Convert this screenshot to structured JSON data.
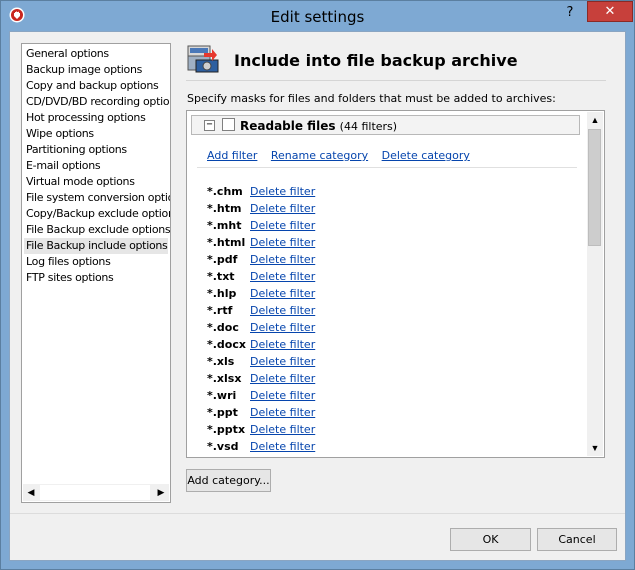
{
  "window": {
    "title": "Edit settings",
    "help_label": "?",
    "close_label": "✕"
  },
  "nav": {
    "items": [
      {
        "label": "General options",
        "selected": false
      },
      {
        "label": "Backup image options",
        "selected": false
      },
      {
        "label": "Copy and backup options",
        "selected": false
      },
      {
        "label": "CD/DVD/BD recording options",
        "selected": false
      },
      {
        "label": "Hot processing options",
        "selected": false
      },
      {
        "label": "Wipe options",
        "selected": false
      },
      {
        "label": "Partitioning options",
        "selected": false
      },
      {
        "label": "E-mail options",
        "selected": false
      },
      {
        "label": "Virtual mode options",
        "selected": false
      },
      {
        "label": "File system conversion options",
        "selected": false
      },
      {
        "label": "Copy/Backup exclude options",
        "selected": false
      },
      {
        "label": "File Backup exclude options",
        "selected": false
      },
      {
        "label": "File Backup include options",
        "selected": true
      },
      {
        "label": "Log files options",
        "selected": false
      },
      {
        "label": "FTP sites options",
        "selected": false
      }
    ]
  },
  "page": {
    "title": "Include into file backup archive",
    "description": "Specify masks for  files and folders that must be added to archives:"
  },
  "category": {
    "toggle": "−",
    "name": "Readable files",
    "count": "(44 filters)",
    "actions": {
      "add": "Add filter",
      "rename": "Rename category",
      "delete": "Delete category"
    }
  },
  "filters": [
    {
      "mask": "*.chm",
      "delete_label": "Delete filter"
    },
    {
      "mask": "*.htm",
      "delete_label": "Delete filter"
    },
    {
      "mask": "*.mht",
      "delete_label": "Delete filter"
    },
    {
      "mask": "*.html",
      "delete_label": "Delete filter"
    },
    {
      "mask": "*.pdf",
      "delete_label": "Delete filter"
    },
    {
      "mask": "*.txt",
      "delete_label": "Delete filter"
    },
    {
      "mask": "*.hlp",
      "delete_label": "Delete filter"
    },
    {
      "mask": "*.rtf",
      "delete_label": "Delete filter"
    },
    {
      "mask": "*.doc",
      "delete_label": "Delete filter"
    },
    {
      "mask": "*.docx",
      "delete_label": "Delete filter"
    },
    {
      "mask": "*.xls",
      "delete_label": "Delete filter"
    },
    {
      "mask": "*.xlsx",
      "delete_label": "Delete filter"
    },
    {
      "mask": "*.wri",
      "delete_label": "Delete filter"
    },
    {
      "mask": "*.ppt",
      "delete_label": "Delete filter"
    },
    {
      "mask": "*.pptx",
      "delete_label": "Delete filter"
    },
    {
      "mask": "*.vsd",
      "delete_label": "Delete filter"
    }
  ],
  "buttons": {
    "add_category": "Add category...",
    "ok": "OK",
    "cancel": "Cancel"
  },
  "colors": {
    "titlebar": "#7ea9d3",
    "close": "#c7403b",
    "link": "#0645ad"
  },
  "icons": {
    "app": "red-shield-icon",
    "header": "backup-drive-icon"
  }
}
